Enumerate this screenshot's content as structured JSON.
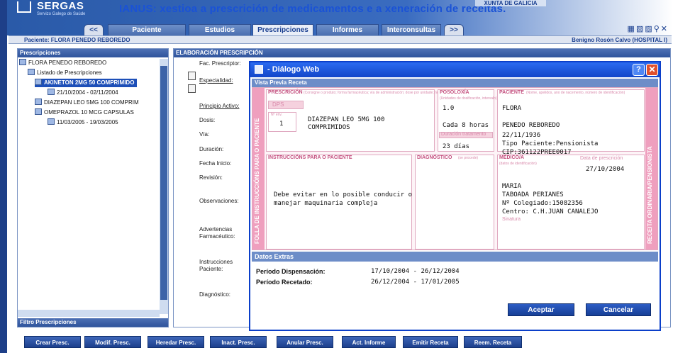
{
  "header": {
    "logo_title": "SERGAS",
    "logo_sub": "Servizo Galego de Saúde",
    "app_title": "IANUS: xestioa a prescrición de medicamentos e a xeneración de receitas.",
    "xunta": "XUNTA DE GALICIA"
  },
  "nav": {
    "back": "<<",
    "tabs": [
      "Paciente",
      "Estudios",
      "Prescripciones",
      "Informes",
      "Interconsultas"
    ],
    "forward": ">>",
    "icons": "▦▧▨⚲✕"
  },
  "patient_bar": {
    "label": "Paciente:  FLORA PENEDO REBOREDO",
    "doctor": "Benigno Rosón Calvo  (HOSPITAL I)"
  },
  "left_panel": {
    "title": "Prescripciones",
    "tree": [
      "FLORA PENEDO REBOREDO",
      "Listado de Prescripciones",
      "AKINETON 2MG 50 COMPRIMIDO",
      "21/10/2004 - 02/11/2004",
      "DIAZEPAN LEO 5MG 100 COMPRIM",
      "OMEPRAZOL 10 MCG CAPSULAS",
      "11/03/2005 - 19/03/2005"
    ],
    "filter": "Filtro Prescripciones"
  },
  "right_panel": {
    "title": "ELABORACIÓN PRESCRIPCIÓN",
    "labels": [
      "Fac. Prescriptor:",
      "Especialidad:",
      "Principio Activo:",
      "Dosis:",
      "Vía:",
      "Duración:",
      "Fecha Inicio:",
      "Revisión:",
      "Observaciones:",
      "Advertencias",
      "Farmacéutico:",
      "Instrucciones",
      "Paciente:",
      "Diagnóstico:"
    ]
  },
  "buttons": [
    "Crear Presc.",
    "Modif. Presc.",
    "Heredar Presc.",
    "Inact. Presc.",
    "Anular Presc.",
    "Act. Informe",
    "Emitir Receta",
    "Reem. Receta"
  ],
  "dialog": {
    "title": "- Diálogo Web",
    "help": "?",
    "close": "✕",
    "vista_title": "Vista Previa Receta",
    "receipt": {
      "side_left": "FOLLA DE INSTRUCCIÓNS PARA O PACIENTE",
      "side_right": "RECEITA ORDINARIA/PENSIONISTA",
      "prescripcion_head": "PRESCRICIÓN",
      "prescripcion_note": "(Consigne o produto; forma farmacéutica; vía de administración; dose por unidade; número de unidades por envase)",
      "dps": "DPS",
      "n_env_label": "Nº env.",
      "n_env": "1",
      "drug_line1": "DIAZEPAN LEO 5MG 100",
      "drug_line2": "COMPRIMIDOS",
      "posoloxia_head": "POSOLOXÍA",
      "posoloxia_note": "(Unidades de dosificación, intervalo)",
      "pos_value": "1.0",
      "intervalo": "Cada 8 horas",
      "duracion_label": "Duración tratamento",
      "duracion": "23 días",
      "paciente_head": "PACIENTE",
      "paciente_note": "(Nome, apelidos, ano de nacemento, número de identificación)",
      "pac_name": "FLORA",
      "pac_surname": "PENEDO REBOREDO",
      "pac_dob": "22/11/1936",
      "pac_type": "Tipo Paciente:Pensionista",
      "pac_cip": "CIP:361122PREE0017",
      "instrucciones_head": "INSTRUCCIÓNS PARA O PACIENTE",
      "instr_line1": "Debe evitar en lo posible conducir o",
      "instr_line2": "manejar maquinaria compleja",
      "diagnostico_head": "DIAGNÓSTICO",
      "diagnostico_note": "(se procede)",
      "medico_head": "MÉDICO/A",
      "medico_note": "(datos de identificación)",
      "fecha_label": "Data de prescrición",
      "fecha": "27/10/2004",
      "med_name": "MARIA",
      "med_surname": "TABOADA PERIANES",
      "med_colegiado": "Nº Colegiado:15082356",
      "med_centro": "Centro: C.H.JUAN CANALEJO",
      "sinatura": "Sinatura"
    },
    "extras_title": "Datos Extras",
    "periodo_disp_label": "Período Dispensación:",
    "periodo_disp": "17/10/2004 - 26/12/2004",
    "periodo_rec_label": "Período Recetado:",
    "periodo_rec": "26/12/2004 - 17/01/2005",
    "accept": "Aceptar",
    "cancel": "Cancelar"
  }
}
